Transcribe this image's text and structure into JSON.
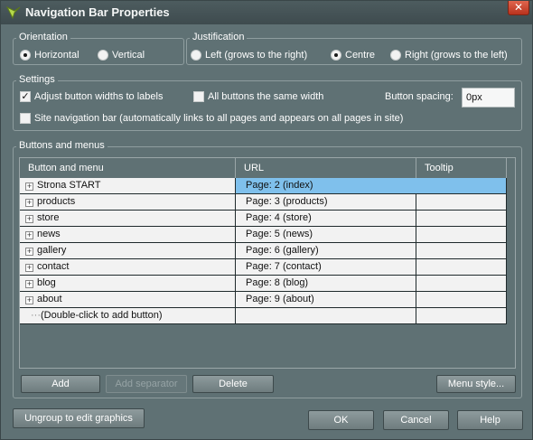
{
  "window": {
    "title": "Navigation Bar Properties"
  },
  "orientation": {
    "label": "Orientation",
    "options": [
      {
        "label": "Horizontal",
        "selected": true
      },
      {
        "label": "Vertical",
        "selected": false
      }
    ]
  },
  "justification": {
    "label": "Justification",
    "options": [
      {
        "label": "Left (grows to the right)",
        "selected": false
      },
      {
        "label": "Centre",
        "selected": true
      },
      {
        "label": "Right (grows to the left)",
        "selected": false
      }
    ]
  },
  "settings": {
    "label": "Settings",
    "adjust_widths": {
      "label": "Adjust button widths to labels",
      "checked": true
    },
    "same_width": {
      "label": "All buttons the same width",
      "checked": false
    },
    "spacing": {
      "label": "Button spacing:",
      "value": "0px"
    },
    "site_nav": {
      "label": "Site navigation bar (automatically links to all pages and appears on all pages in site)",
      "checked": false
    }
  },
  "buttons_menus": {
    "label": "Buttons and menus",
    "columns": [
      "Button and menu",
      "URL",
      "Tooltip"
    ],
    "rows": [
      {
        "name": "Strona START",
        "url": "Page: 2 (index)",
        "tooltip": "",
        "selected": true
      },
      {
        "name": "products",
        "url": "Page: 3 (products)",
        "tooltip": ""
      },
      {
        "name": "store",
        "url": "Page: 4 (store)",
        "tooltip": ""
      },
      {
        "name": "news",
        "url": "Page: 5 (news)",
        "tooltip": ""
      },
      {
        "name": "gallery",
        "url": "Page: 6 (gallery)",
        "tooltip": ""
      },
      {
        "name": "contact",
        "url": "Page: 7 (contact)",
        "tooltip": ""
      },
      {
        "name": "blog",
        "url": "Page: 8 (blog)",
        "tooltip": ""
      },
      {
        "name": "about",
        "url": "Page: 9 (about)",
        "tooltip": ""
      }
    ],
    "add_row": "(Double-click to add button)"
  },
  "actions": {
    "add": "Add",
    "add_separator": "Add separator",
    "delete": "Delete",
    "menu_style": "Menu style..."
  },
  "footer": {
    "ungroup": "Ungroup to edit graphics",
    "ok": "OK",
    "cancel": "Cancel",
    "help": "Help"
  },
  "colors": {
    "dialog_bg": "#5f7174",
    "selection": "#7fc0ec",
    "close": "#c9432c"
  }
}
